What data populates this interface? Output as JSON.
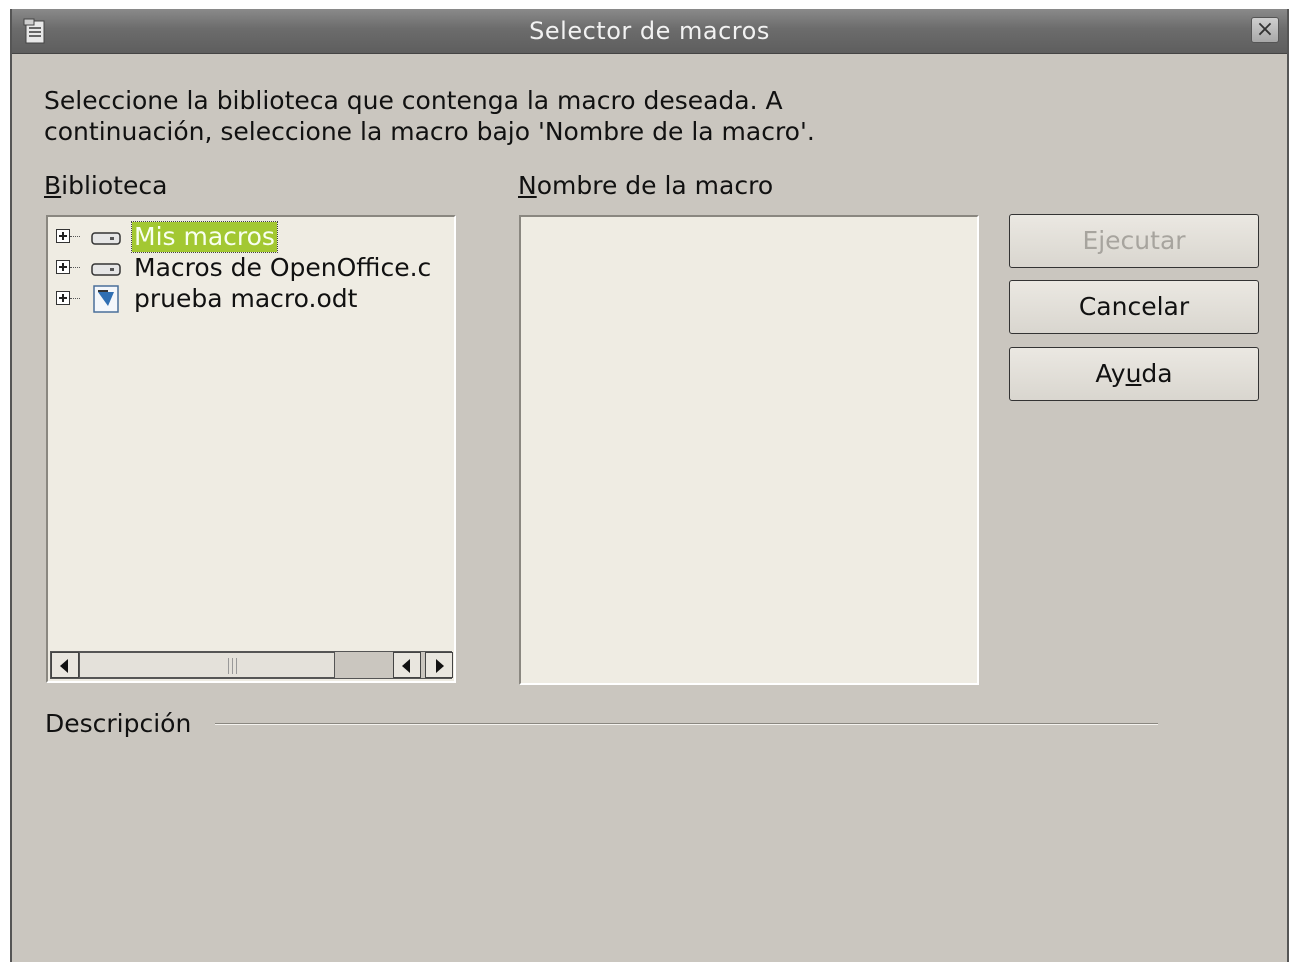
{
  "window": {
    "title": "Selector de macros",
    "close_glyph": "×"
  },
  "instructions": {
    "line1": "Seleccione la biblioteca que contenga la macro deseada. A",
    "line2": "continuación, seleccione la macro bajo 'Nombre de la macro'."
  },
  "library": {
    "label_first": "B",
    "label_rest": "iblioteca",
    "items": [
      {
        "label": "Mis macros",
        "icon": "drive-icon",
        "selected": true
      },
      {
        "label": "Macros de OpenOffice.c",
        "icon": "drive-icon",
        "selected": false
      },
      {
        "label": "prueba macro.odt",
        "icon": "document-icon",
        "selected": false
      }
    ]
  },
  "macro_name": {
    "label_first": "N",
    "label_rest": "ombre de la macro",
    "items": []
  },
  "buttons": {
    "run": "Ejecutar",
    "cancel": "Cancelar",
    "help_pre": "Ay",
    "help_u": "u",
    "help_post": "da"
  },
  "description": {
    "label": "Descripción"
  },
  "colors": {
    "selection": "#a3c832",
    "dialog_bg": "#cac6bf",
    "list_bg": "#efece3"
  }
}
